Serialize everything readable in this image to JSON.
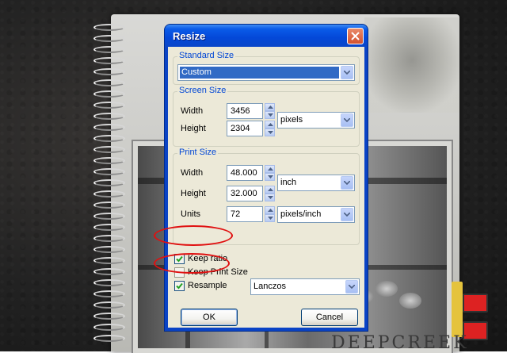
{
  "dialog": {
    "title": "Resize",
    "standard_size": {
      "label": "Standard Size",
      "value": "Custom"
    },
    "screen_size": {
      "label": "Screen Size",
      "width_label": "Width",
      "width_value": "3456",
      "height_label": "Height",
      "height_value": "2304",
      "unit": "pixels"
    },
    "print_size": {
      "label": "Print Size",
      "width_label": "Width",
      "width_value": "48.000",
      "height_label": "Height",
      "height_value": "32.000",
      "unit": "inch",
      "units_label": "Units",
      "units_value": "72",
      "units_unit": "pixels/inch"
    },
    "keep_ratio": {
      "label": "Keep ratio",
      "checked": true
    },
    "keep_print_size": {
      "label": "Keep Print Size",
      "checked": false
    },
    "resample": {
      "label": "Resample",
      "checked": true,
      "method": "Lanczos"
    },
    "ok_label": "OK",
    "cancel_label": "Cancel"
  },
  "background": {
    "book_title": "DEEPCREEK"
  },
  "colors": {
    "titlebar": "#0a5be8",
    "client": "#ece9d8",
    "group_label": "#0046d5",
    "highlight": "#316ac5",
    "annotation_ring": "#e01010"
  }
}
